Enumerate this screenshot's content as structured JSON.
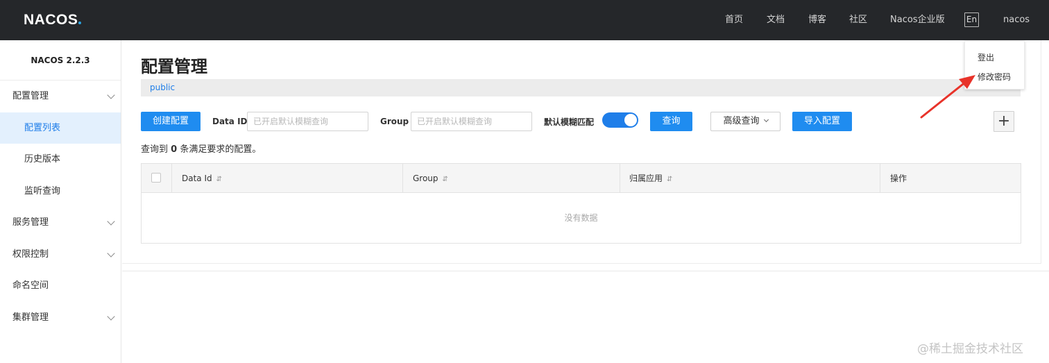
{
  "app": {
    "logo": "NACOS",
    "version": "NACOS 2.2.3"
  },
  "topnav": [
    {
      "label": "首页"
    },
    {
      "label": "文档"
    },
    {
      "label": "博客"
    },
    {
      "label": "社区"
    },
    {
      "label": "Nacos企业版"
    }
  ],
  "lang_button": "En",
  "user": "nacos",
  "user_menu": {
    "logout": "登出",
    "change_password": "修改密码"
  },
  "sidebar": {
    "items": [
      {
        "label": "配置管理",
        "has_children": true
      },
      {
        "label": "配置列表",
        "active": true
      },
      {
        "label": "历史版本"
      },
      {
        "label": "监听查询"
      },
      {
        "label": "服务管理",
        "has_children": true
      },
      {
        "label": "权限控制",
        "has_children": true
      },
      {
        "label": "命名空间"
      },
      {
        "label": "集群管理",
        "has_children": true
      }
    ]
  },
  "page": {
    "title": "配置管理",
    "namespace": "public"
  },
  "toolbar": {
    "create_button": "创建配置",
    "data_id_label": "Data ID",
    "data_id_placeholder": "已开启默认模糊查询",
    "group_label": "Group",
    "group_placeholder": "已开启默认模糊查询",
    "fuzzy_label": "默认模糊匹配",
    "fuzzy_enabled": true,
    "search_button": "查询",
    "advanced_button": "高级查询",
    "import_button": "导入配置",
    "plus": "+"
  },
  "summary": {
    "prefix": "查询到",
    "count": "0",
    "suffix": "条满足要求的配置。"
  },
  "table": {
    "columns": [
      {
        "label": "Data Id",
        "sortable": true
      },
      {
        "label": "Group",
        "sortable": true
      },
      {
        "label": "归属应用",
        "sortable": true
      },
      {
        "label": "操作",
        "sortable": false
      }
    ],
    "sort_glyph": "⇵",
    "empty_text": "没有数据"
  },
  "watermark": "@稀土掘金技术社区",
  "colors": {
    "primary": "#1f8cf0",
    "topbar": "#25272a",
    "active_bg": "#e3f0fd",
    "arrow": "#e8332a"
  }
}
